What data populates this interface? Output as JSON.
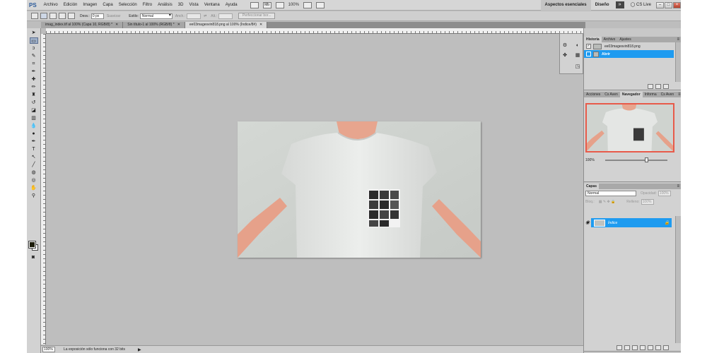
{
  "app": {
    "logo": "PS"
  },
  "menu": {
    "items": [
      "Archivo",
      "Edición",
      "Imagen",
      "Capa",
      "Selección",
      "Filtro",
      "Análisis",
      "3D",
      "Vista",
      "Ventana",
      "Ayuda"
    ],
    "zoom": "100%",
    "mb_label": "Mb"
  },
  "workspace": {
    "essentials": "Aspectos esenciales",
    "design": "Diseño",
    "more": "»",
    "cslive": "CS Live"
  },
  "options": {
    "feather_label": "Desv.:",
    "feather_value": "0 px",
    "antialias_label": "Suavizar",
    "style_label": "Estilo:",
    "style_value": "Normal",
    "width_label": "Anch.:",
    "height_label": "Alt.:",
    "refine_button": "Perfeccionar bor..."
  },
  "tabs": [
    {
      "label": "imag_index.tif al 100% (Capa 10, RGB/8) *"
    },
    {
      "label": "Sin título-1 al 100% (RGB/8) *"
    },
    {
      "label": "ee03magesvin818.png al 100% (Índice/8#)"
    }
  ],
  "status": {
    "zoom": "100%",
    "message": "La exposición sólo funciona con 32 bits",
    "arrow": "▶"
  },
  "history_panel": {
    "tab": "Historia",
    "secondary_tabs": [
      "Archivo",
      "Ajustes"
    ],
    "snapshot": "ee03magesvin818.png",
    "state": "Abrir"
  },
  "navigator_panel": {
    "tabs": [
      "Acciones",
      "Cs Aven",
      "Navegador",
      "Informa",
      "Cs Aven"
    ],
    "zoom": "100%"
  },
  "layers_panel": {
    "tab": "Capas",
    "blend": "Normal",
    "opacity_label": "Opacidad:",
    "opacity_value": "100%",
    "lock_label": "Bloq.:",
    "fill_label": "Relleno:",
    "fill_value": "100%",
    "layer_name": "Índice"
  },
  "colors": {
    "foreground": "#1c1c0a",
    "background": "#ffffff",
    "accent": "#1e9bf0",
    "navigator_frame": "#e85a4a"
  }
}
